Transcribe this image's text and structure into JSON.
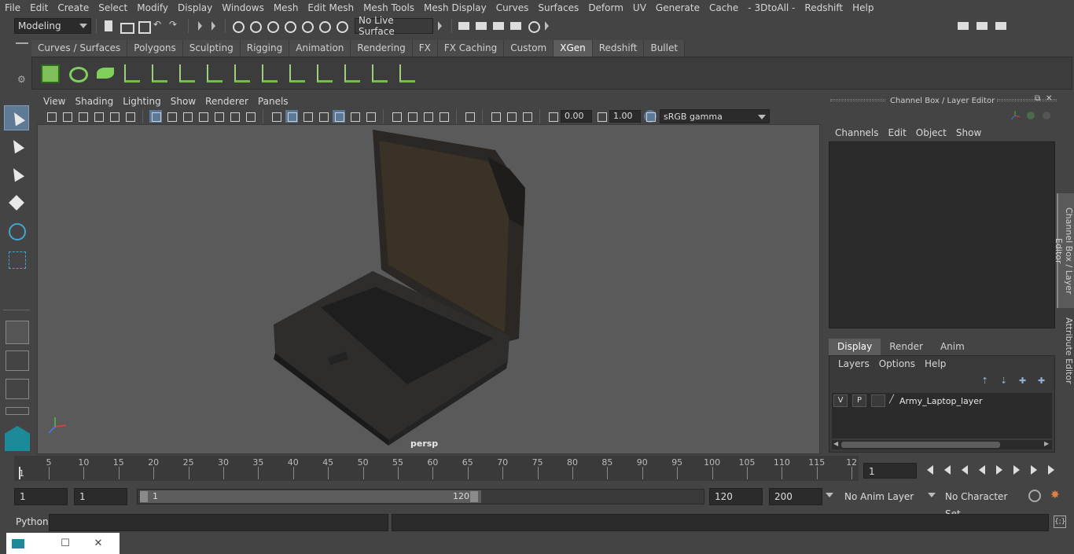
{
  "menubar": [
    "File",
    "Edit",
    "Create",
    "Select",
    "Modify",
    "Display",
    "Windows",
    "Mesh",
    "Edit Mesh",
    "Mesh Tools",
    "Mesh Display",
    "Curves",
    "Surfaces",
    "Deform",
    "UV",
    "Generate",
    "Cache",
    "- 3DtoAll -",
    "Redshift",
    "Help"
  ],
  "statusline": {
    "mode": "Modeling",
    "live_surface": "No Live Surface"
  },
  "shelf_tabs": [
    "Curves / Surfaces",
    "Polygons",
    "Sculpting",
    "Rigging",
    "Animation",
    "Rendering",
    "FX",
    "FX Caching",
    "Custom",
    "XGen",
    "Redshift",
    "Bullet"
  ],
  "shelf_active": "XGen",
  "viewport": {
    "menu": [
      "View",
      "Shading",
      "Lighting",
      "Show",
      "Renderer",
      "Panels"
    ],
    "exposure": "0.00",
    "gamma": "1.00",
    "color_space": "sRGB gamma",
    "camera_label": "persp"
  },
  "channel_box": {
    "title": "Channel Box / Layer Editor",
    "menu": [
      "Channels",
      "Edit",
      "Object",
      "Show"
    ]
  },
  "side_tabs": [
    "Channel Box / Layer Editor",
    "Attribute Editor"
  ],
  "layer_editor": {
    "tabs": [
      "Display",
      "Render",
      "Anim"
    ],
    "active_tab": "Display",
    "menu": [
      "Layers",
      "Options",
      "Help"
    ],
    "layer": {
      "v": "V",
      "p": "P",
      "name": "Army_Laptop_layer"
    }
  },
  "timeline": {
    "ticks": [
      "5",
      "10",
      "15",
      "20",
      "25",
      "30",
      "35",
      "40",
      "45",
      "50",
      "55",
      "60",
      "65",
      "70",
      "75",
      "80",
      "85",
      "90",
      "95",
      "100",
      "105",
      "110",
      "115",
      "12"
    ],
    "start_label": "1",
    "current_frame": "1"
  },
  "range": {
    "start": "1",
    "playback_start": "1",
    "slider_start": "1",
    "slider_end": "120",
    "playback_end": "120",
    "end": "200",
    "anim_layer": "No Anim Layer",
    "character_set": "No Character Set"
  },
  "command_line": {
    "language": "Python"
  },
  "colors": {
    "accent_blue": "#5e7a94",
    "shelf_green": "#7fcf5a"
  }
}
